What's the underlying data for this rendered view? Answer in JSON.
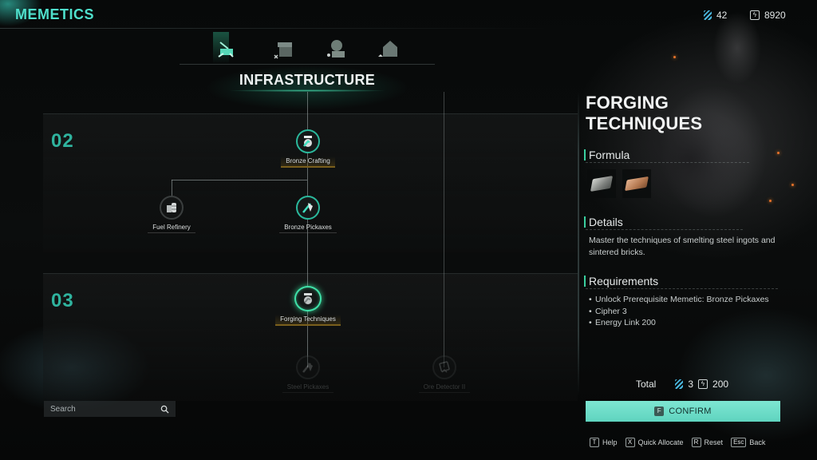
{
  "app": {
    "title": "MEMETICS"
  },
  "currency": {
    "cipher": {
      "icon": "cipher-icon",
      "value": "42"
    },
    "energy_link": {
      "icon": "energy-link-icon",
      "value": "8920"
    }
  },
  "category_tabs": [
    {
      "name": "infrastructure",
      "icon": "drill-icon",
      "active": true
    },
    {
      "name": "workshop",
      "icon": "workbench-icon",
      "active": false
    },
    {
      "name": "farming",
      "icon": "plant-icon",
      "active": false
    },
    {
      "name": "housing",
      "icon": "house-icon",
      "active": false
    }
  ],
  "section_title": "INFRASTRUCTURE",
  "tiers": [
    {
      "label": "02"
    },
    {
      "label": "03"
    }
  ],
  "nodes": [
    {
      "id": "bronze-crafting",
      "label": "Bronze Crafting",
      "icon": "crucible-icon",
      "state": "unlocked"
    },
    {
      "id": "fuel-refinery",
      "label": "Fuel Refinery",
      "icon": "fuel-barrel-icon",
      "state": "locked"
    },
    {
      "id": "bronze-pickaxes",
      "label": "Bronze Pickaxes",
      "icon": "pickaxe-icon",
      "state": "unlocked"
    },
    {
      "id": "forging-techniques",
      "label": "Forging Techniques",
      "icon": "crucible-icon",
      "state": "selected"
    },
    {
      "id": "steel-pickaxes",
      "label": "Steel Pickaxes",
      "icon": "pickaxe-icon",
      "state": "unavailable"
    },
    {
      "id": "ore-detector-ii",
      "label": "Ore Detector II",
      "icon": "detector-icon",
      "state": "unavailable"
    }
  ],
  "search": {
    "placeholder": "Search"
  },
  "detail": {
    "title_line1": "FORGING",
    "title_line2": "TECHNIQUES",
    "formula_heading": "Formula",
    "formula_items": [
      {
        "name": "Steel Ingot",
        "icon": "steel-ingot-icon"
      },
      {
        "name": "Sintered Brick",
        "icon": "sintered-brick-icon"
      }
    ],
    "details_heading": "Details",
    "details_text": "Master the techniques of smelting steel ingots and sintered bricks.",
    "requirements_heading": "Requirements",
    "requirements": [
      "Unlock Prerequisite Memetic: Bronze Pickaxes",
      "Cipher 3",
      "Energy Link 200"
    ]
  },
  "total": {
    "label": "Total",
    "cipher": "3",
    "energy_link": "200"
  },
  "confirm": {
    "key": "F",
    "label": "CONFIRM"
  },
  "hints": [
    {
      "key": "T",
      "label": "Help"
    },
    {
      "key": "X",
      "label": "Quick Allocate"
    },
    {
      "key": "R",
      "label": "Reset"
    },
    {
      "key": "Esc",
      "label": "Back"
    }
  ],
  "colors": {
    "accent": "#4fe0cc",
    "tier_number": "#2fb39e",
    "confirm_bg": "#6fdcc7",
    "node_ring": "#2ab89c",
    "selected_glow": "#3fe0a8",
    "gold_underline": "#7a5f1c"
  }
}
